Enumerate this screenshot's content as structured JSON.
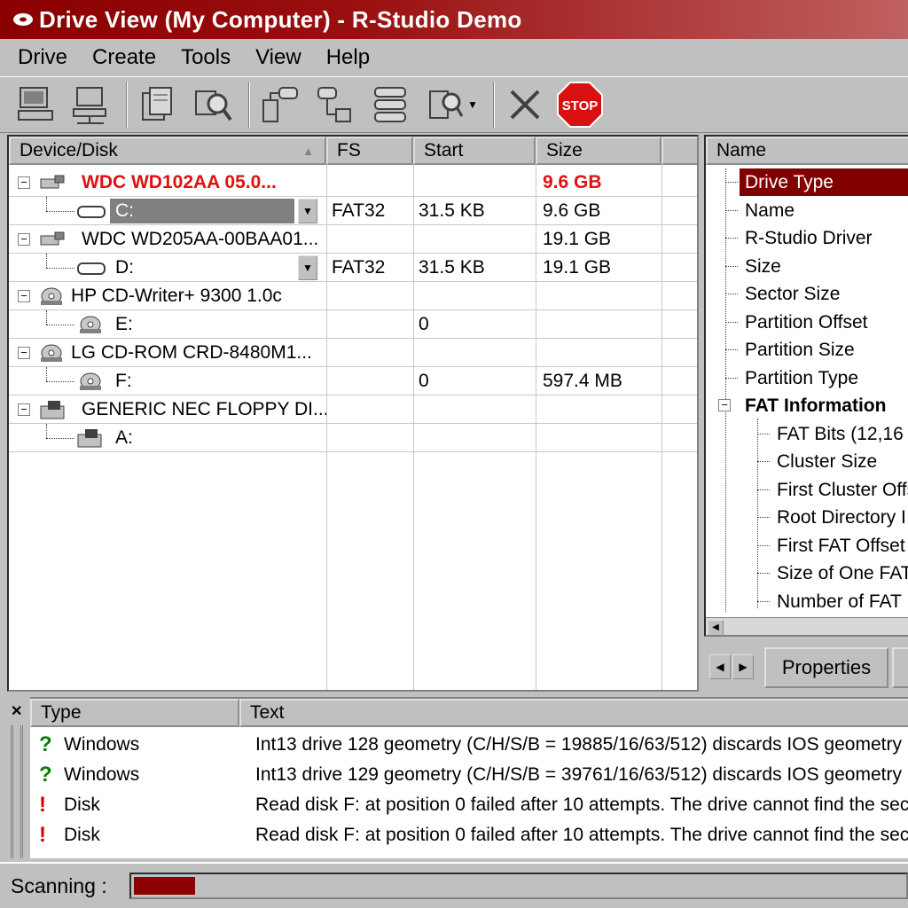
{
  "window": {
    "title": "Drive View (My Computer) - R-Studio Demo"
  },
  "menu": [
    "Drive",
    "Create",
    "Tools",
    "View",
    "Help"
  ],
  "toolbar": {
    "buttons": [
      "computer-icon",
      "network-computer-icon",
      "open-files-icon",
      "find-icon",
      "create-region-icon",
      "create-image-icon",
      "create-raid-icon",
      "scan-icon",
      "close-icon",
      "stop-icon"
    ],
    "stop_label": "STOP"
  },
  "device_table": {
    "columns": [
      "Device/Disk",
      "FS",
      "Start",
      "Size"
    ],
    "rows": [
      {
        "name": "WDC WD102AA 05.0...",
        "fs": "",
        "start": "",
        "size": "9.6 GB",
        "kind": "disk",
        "highlight": true
      },
      {
        "name": "C:",
        "fs": "FAT32",
        "start": "31.5 KB",
        "size": "9.6 GB",
        "kind": "partition",
        "selected": true
      },
      {
        "name": "WDC WD205AA-00BAA01...",
        "fs": "",
        "start": "",
        "size": "19.1 GB",
        "kind": "disk"
      },
      {
        "name": "D:",
        "fs": "FAT32",
        "start": "31.5 KB",
        "size": "19.1 GB",
        "kind": "partition"
      },
      {
        "name": "HP CD-Writer+ 9300 1.0c",
        "fs": "",
        "start": "",
        "size": "",
        "kind": "cdrom"
      },
      {
        "name": "E:",
        "fs": "",
        "start": "0",
        "size": "",
        "kind": "cd-partition"
      },
      {
        "name": "LG CD-ROM CRD-8480M1...",
        "fs": "",
        "start": "",
        "size": "",
        "kind": "cdrom"
      },
      {
        "name": "F:",
        "fs": "",
        "start": "0",
        "size": "597.4 MB",
        "kind": "cd-partition"
      },
      {
        "name": "GENERIC NEC FLOPPY DI...",
        "fs": "",
        "start": "",
        "size": "",
        "kind": "floppy"
      },
      {
        "name": "A:",
        "fs": "",
        "start": "",
        "size": "",
        "kind": "floppy-partition"
      }
    ]
  },
  "properties": {
    "header": "Name",
    "items": [
      {
        "label": "Drive Type",
        "level": 1,
        "selected": true
      },
      {
        "label": "Name",
        "level": 1
      },
      {
        "label": "R-Studio Driver",
        "level": 1
      },
      {
        "label": "Size",
        "level": 1
      },
      {
        "label": "Sector Size",
        "level": 1
      },
      {
        "label": "Partition Offset",
        "level": 1
      },
      {
        "label": "Partition Size",
        "level": 1
      },
      {
        "label": "Partition Type",
        "level": 1
      },
      {
        "label": "FAT Information",
        "level": 0,
        "bold": true
      },
      {
        "label": "FAT Bits (12,16",
        "level": 2
      },
      {
        "label": "Cluster Size",
        "level": 2
      },
      {
        "label": "First Cluster Offs",
        "level": 2
      },
      {
        "label": "Root Directory I",
        "level": 2
      },
      {
        "label": "First FAT Offset",
        "level": 2
      },
      {
        "label": "Size of One FAT",
        "level": 2
      },
      {
        "label": "Number of FAT",
        "level": 2
      }
    ],
    "tabs": [
      "Properties"
    ]
  },
  "log": {
    "columns": [
      "Type",
      "Text"
    ],
    "rows": [
      {
        "icon": "question-icon",
        "type": "Windows",
        "text": "Int13 drive 128 geometry (C/H/S/B = 19885/16/63/512) discards IOS geometry"
      },
      {
        "icon": "question-icon",
        "type": "Windows",
        "text": "Int13 drive 129 geometry (C/H/S/B = 39761/16/63/512) discards IOS geometry"
      },
      {
        "icon": "exclamation-icon",
        "type": "Disk",
        "text": "Read disk F: at position 0 failed after 10 attempts. The drive cannot find the sec"
      },
      {
        "icon": "exclamation-icon",
        "type": "Disk",
        "text": "Read disk F: at position 0 failed after 10 attempts. The drive cannot find the sec"
      }
    ]
  },
  "status": {
    "label": "Scanning :",
    "progress": 0.08
  },
  "colors": {
    "title_bar": "#8a0000",
    "selection": "#800000",
    "highlight_text": "#e01010",
    "progress": "#8b0000"
  }
}
